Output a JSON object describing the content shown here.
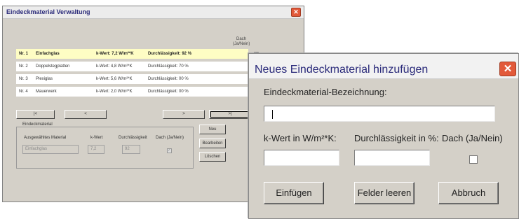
{
  "main_window": {
    "title": "Eindeckmaterial Verwaltung",
    "close_glyph": "✕",
    "dach_header": [
      "Dach",
      "(Ja/Nein)"
    ],
    "rows": [
      {
        "nr": "Nr. 1",
        "name": "Einfachglas",
        "k": "k-Wert: 7,2 W/m²*K",
        "d": "Durchlässigkeit: 92 %",
        "dach": true,
        "selected": true
      },
      {
        "nr": "Nr. 2",
        "name": "Doppelstegplatten",
        "k": "k-Wert: 4,8 W/m²*K",
        "d": "Durchlässigkeit: 70 %",
        "dach": true,
        "selected": false
      },
      {
        "nr": "Nr. 3",
        "name": "Plexiglas",
        "k": "k-Wert: 5,6 W/m²*K",
        "d": "Durchlässigkeit: 00 %",
        "dach": true,
        "selected": false
      },
      {
        "nr": "Nr. 4",
        "name": "Mauerwerk",
        "k": "k-Wert: 2,0 W/m²*K",
        "d": "Durchlässigkeit: 00 %",
        "dach": false,
        "selected": false
      }
    ],
    "nav": {
      "first": "|<",
      "prev": "<",
      "next": ">",
      "last": ">|"
    },
    "detail": {
      "legend": "Eindeckmaterial",
      "label_material": "Ausgewähltes Material",
      "label_k": "k-Wert",
      "label_d": "Durchlässigkeit",
      "label_dach": "Dach (Ja/Nein)",
      "value_material": "Einfachglas",
      "value_k": "7,2",
      "value_d": "92",
      "dach_checked": true
    },
    "buttons": {
      "new": "Neu",
      "edit": "Bearbeiten",
      "delete": "Löschen"
    }
  },
  "dialog": {
    "title": "Neues Eindeckmaterial hinzufügen",
    "close_glyph": "✕",
    "label_name": "Eindeckmaterial-Bezeichnung:",
    "name_value": "",
    "label_k": "k-Wert in W/m²*K:",
    "k_value": "",
    "label_d": "Durchlässigkeit in %:",
    "d_value": "",
    "label_dach": "Dach (Ja/Nein)",
    "dach_checked": false,
    "btn_insert": "Einfügen",
    "btn_clear": "Felder leeren",
    "btn_cancel": "Abbruch"
  },
  "colors": {
    "selected_row": "#fefdc4",
    "close_button": "#e2593a",
    "title_text": "#2a2a7a"
  }
}
